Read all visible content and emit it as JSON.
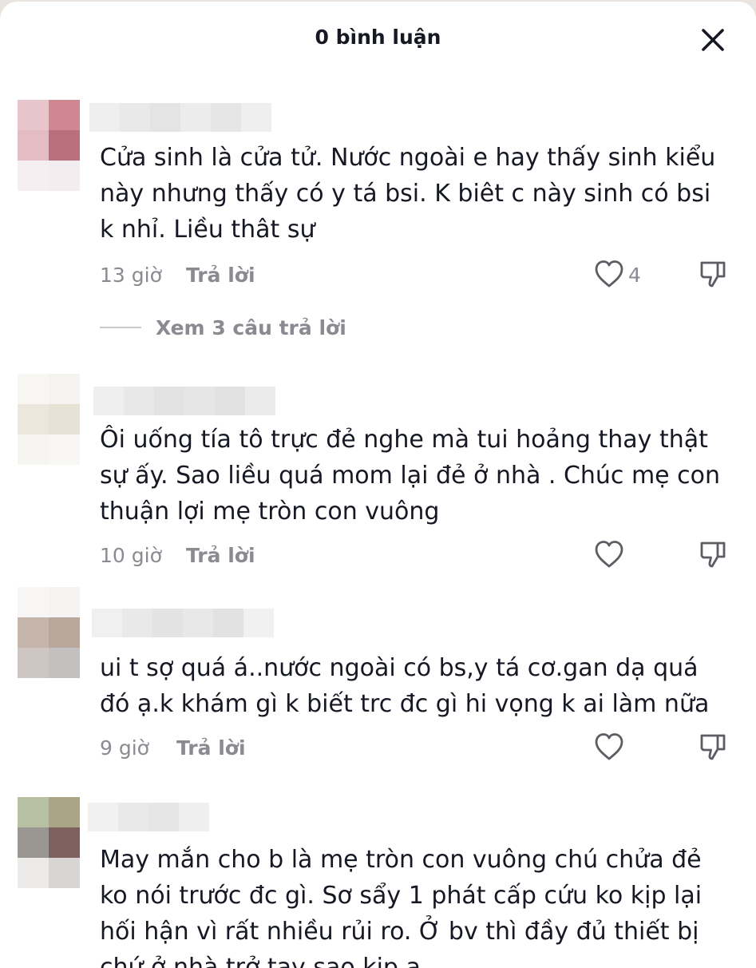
{
  "header": {
    "title": "0 bình luận",
    "close_icon": "close-icon"
  },
  "reply_label": "Trả lời",
  "comments": [
    {
      "text": "Cửa sinh là cửa tử. Nước ngoài e hay thấy sinh kiểu\nnày nhưng thấy có y tá bsi. K biêt c này sinh có bsi\nk nhỉ. Liều thât sự",
      "time": "13 giờ",
      "likes": "4",
      "view_replies": "Xem 3 câu trả lời"
    },
    {
      "text": "Ôi uống tía tô trực đẻ nghe mà tui hoảng thay thật\nsự ấy. Sao liều quá mom lại đẻ ở nhà . Chúc mẹ con\nthuận lợi mẹ tròn con vuông",
      "time": "10 giờ"
    },
    {
      "text": "ui t sợ quá á..nước ngoài có bs,y tá cơ.gan dạ quá\nđó ạ.k khám gì k biết trc đc gì hi vọng k ai làm nữa",
      "time": "9 giờ"
    },
    {
      "text": "May mắn cho b là mẹ tròn con vuông chú chửa đẻ\nko nói trước đc gì. Sơ sẩy 1 phát cấp cứu ko kịp lại\nhối hận vì rất nhiều rủi ro. Ở bv thì đầy đủ thiết bị\nchứ ở nhà trở tay sao kịp a"
    }
  ],
  "icons": {
    "like": "heart-icon",
    "dislike": "thumbs-down-icon"
  },
  "colors": {
    "text": "#161823",
    "muted": "#8a8b91",
    "background": "#ffffff"
  }
}
